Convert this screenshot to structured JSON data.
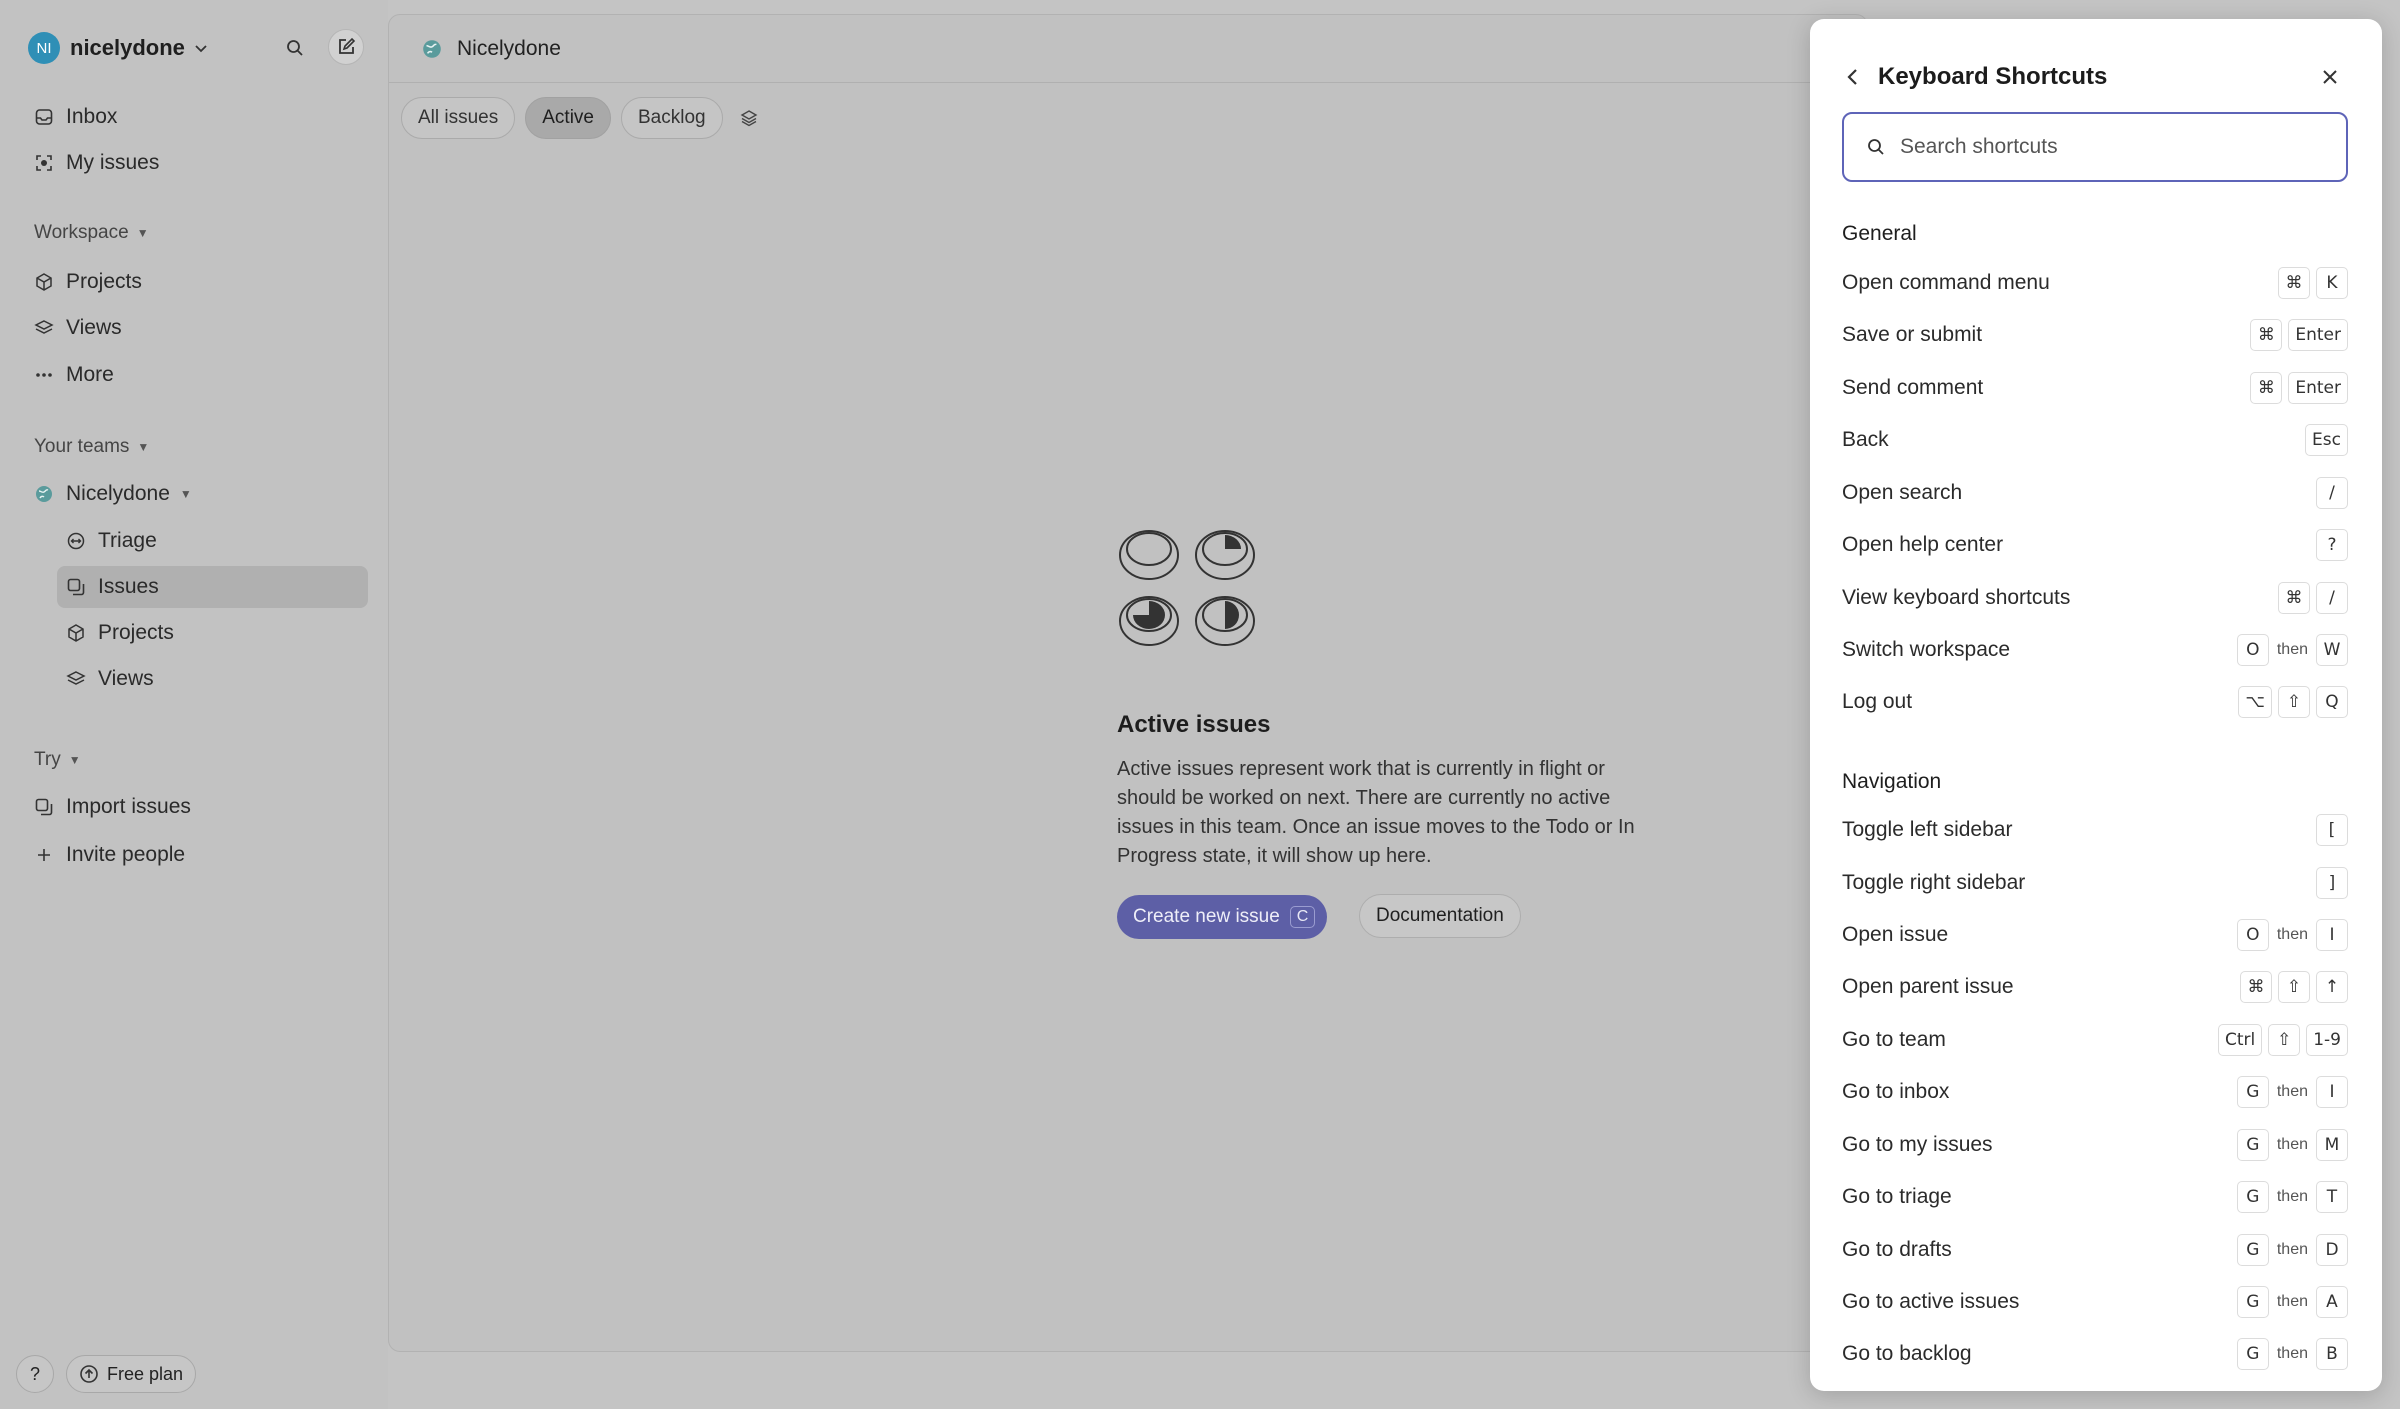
{
  "sidebar": {
    "workspace_initials": "NI",
    "workspace_name": "nicelydone",
    "top_items": [
      {
        "label": "Inbox"
      },
      {
        "label": "My issues"
      }
    ],
    "workspace_section": "Workspace",
    "workspace_items": [
      {
        "label": "Projects"
      },
      {
        "label": "Views"
      },
      {
        "label": "More"
      }
    ],
    "teams_section": "Your teams",
    "team_name": "Nicelydone",
    "team_items": [
      {
        "label": "Triage"
      },
      {
        "label": "Issues"
      },
      {
        "label": "Projects"
      },
      {
        "label": "Views"
      }
    ],
    "try_section": "Try",
    "try_items": [
      {
        "label": "Import issues"
      },
      {
        "label": "Invite people"
      }
    ],
    "help_label": "?",
    "plan_label": "Free plan"
  },
  "main": {
    "title": "Nicelydone",
    "tabs": [
      {
        "label": "All issues"
      },
      {
        "label": "Active"
      },
      {
        "label": "Backlog"
      }
    ],
    "empty_title": "Active issues",
    "empty_desc": "Active issues represent work that is currently in flight or should be worked on next. There are currently no active issues in this team. Once an issue moves to the Todo or In Progress state, it will show up here.",
    "primary_button": "Create new issue",
    "primary_shortcut": "C",
    "secondary_button": "Documentation"
  },
  "panel": {
    "title": "Keyboard Shortcuts",
    "search_placeholder": "Search shortcuts",
    "then": "then",
    "general_title": "General",
    "general": [
      {
        "label": "Open command menu",
        "k1": "⌘",
        "k2": "K"
      },
      {
        "label": "Save or submit",
        "k1": "⌘",
        "k2": "Enter"
      },
      {
        "label": "Send comment",
        "k1": "⌘",
        "k2": "Enter"
      },
      {
        "label": "Back",
        "k1": "Esc"
      },
      {
        "label": "Open search",
        "k1": "/"
      },
      {
        "label": "Open help center",
        "k1": "?"
      },
      {
        "label": "View keyboard shortcuts",
        "k1": "⌘",
        "k2": "/"
      },
      {
        "label": "Switch workspace",
        "k1": "O",
        "k2": "W"
      },
      {
        "label": "Log out",
        "k1": "⌥",
        "k2": "⇧",
        "k3": "Q"
      }
    ],
    "navigation_title": "Navigation",
    "navigation": [
      {
        "label": "Toggle left sidebar",
        "k1": "["
      },
      {
        "label": "Toggle right sidebar",
        "k1": "]"
      },
      {
        "label": "Open issue",
        "k1": "O",
        "k2": "I"
      },
      {
        "label": "Open parent issue",
        "k1": "⌘",
        "k2": "⇧",
        "k3": "↑"
      },
      {
        "label": "Go to team",
        "k1": "Ctrl",
        "k2": "⇧",
        "k3": "1-9"
      },
      {
        "label": "Go to inbox",
        "k1": "G",
        "k2": "I"
      },
      {
        "label": "Go to my issues",
        "k1": "G",
        "k2": "M"
      },
      {
        "label": "Go to triage",
        "k1": "G",
        "k2": "T"
      },
      {
        "label": "Go to drafts",
        "k1": "G",
        "k2": "D"
      },
      {
        "label": "Go to active issues",
        "k1": "G",
        "k2": "A"
      },
      {
        "label": "Go to backlog",
        "k1": "G",
        "k2": "B"
      }
    ]
  },
  "colors": {
    "accent": "#5e64b8",
    "workspace_avatar": "#2f8fb6",
    "overlay_bg": "#c4c4c4"
  }
}
